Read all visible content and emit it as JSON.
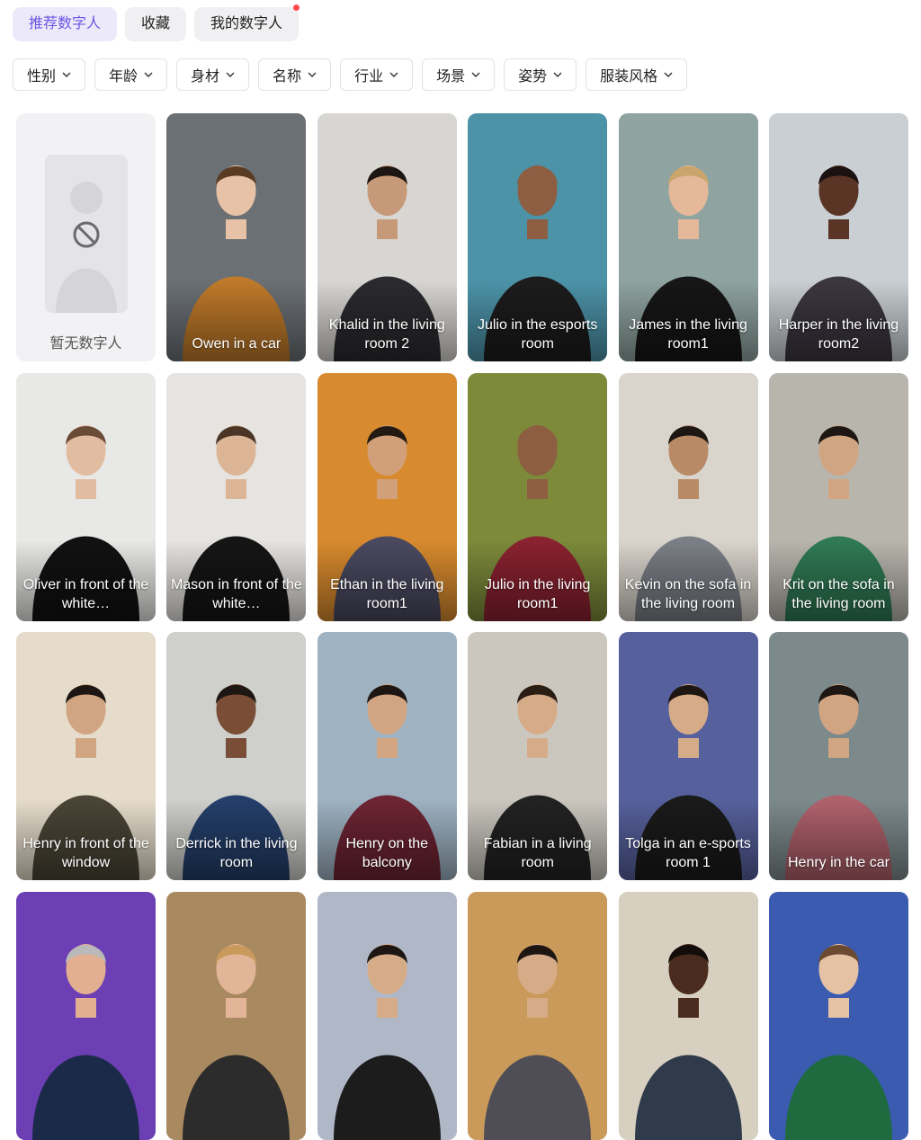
{
  "tabs": [
    {
      "label": "推荐数字人",
      "active": true
    },
    {
      "label": "收藏",
      "active": false
    },
    {
      "label": "我的数字人",
      "active": false,
      "badge_dot": true
    }
  ],
  "filters": [
    {
      "label": "性别"
    },
    {
      "label": "年龄"
    },
    {
      "label": "身材"
    },
    {
      "label": "名称"
    },
    {
      "label": "行业"
    },
    {
      "label": "场景"
    },
    {
      "label": "姿势"
    },
    {
      "label": "服装风格"
    }
  ],
  "empty_card": {
    "label": "暂无数字人",
    "icon": "no-avatar-icon"
  },
  "cards": [
    {
      "name": "Owen in a car",
      "bg": "#6b7075",
      "shirt": "#c07a2a",
      "skin": "#e8c2a6",
      "hair": "#5a3b24"
    },
    {
      "name": "Khalid in the living room 2",
      "bg": "#d8d6d2",
      "shirt": "#2b2b2f",
      "skin": "#c69a78",
      "hair": "#1d1612"
    },
    {
      "name": "Julio in the esports room",
      "bg": "#4c93a8",
      "shirt": "#1c1c1c",
      "skin": "#8d5e42",
      "hair": "#8d5e42"
    },
    {
      "name": "James in the living room1",
      "bg": "#8fa3a0",
      "shirt": "#161616",
      "skin": "#e6b89a",
      "hair": "#c9a56b"
    },
    {
      "name": "Harper in the living room2",
      "bg": "#c9cfd2",
      "shirt": "#3b3640",
      "skin": "#5a3526",
      "hair": "#1a1210"
    },
    {
      "name": "Oliver in front of the white…",
      "bg": "#e8e8e6",
      "shirt": "#111111",
      "skin": "#e2bca0",
      "hair": "#6a4c36"
    },
    {
      "name": "Mason in front of the white…",
      "bg": "#e6e4e0",
      "shirt": "#151515",
      "skin": "#dcb596",
      "hair": "#4a3526"
    },
    {
      "name": "Ethan in the living room1",
      "bg": "#d88a2e",
      "shirt": "#4a4960",
      "skin": "#d1a07a",
      "hair": "#231a14"
    },
    {
      "name": "Julio in the living room1",
      "bg": "#7c8a3a",
      "shirt": "#8a2230",
      "skin": "#8d5e42",
      "hair": "#8d5e42"
    },
    {
      "name": "Kevin on the sofa in the living room",
      "bg": "#d9d4cc",
      "shirt": "#7b7f86",
      "skin": "#b98a66",
      "hair": "#1d1612"
    },
    {
      "name": "Krit on the sofa in the living room",
      "bg": "#b8b5ad",
      "shirt": "#2f7a54",
      "skin": "#d1a582",
      "hair": "#1d1612"
    },
    {
      "name": "Henry in front of the window",
      "bg": "#e5dccb",
      "shirt": "#4a4536",
      "skin": "#d1a582",
      "hair": "#1d1612"
    },
    {
      "name": "Derrick in the living room",
      "bg": "#cfcfcb",
      "shirt": "#243f6b",
      "skin": "#7a4e36",
      "hair": "#1d1612"
    },
    {
      "name": "Henry on the balcony",
      "bg": "#9eb2c2",
      "shirt": "#6e2433",
      "skin": "#d1a582",
      "hair": "#1d1612"
    },
    {
      "name": "Fabian in a living room",
      "bg": "#cbc7bf",
      "shirt": "#222222",
      "skin": "#d6ac88",
      "hair": "#2a1d14"
    },
    {
      "name": "Tolga in an e-sports room 1",
      "bg": "#56609c",
      "shirt": "#1a1a1a",
      "skin": "#d6ac88",
      "hair": "#1d1612"
    },
    {
      "name": "Henry in the car",
      "bg": "#7d8a8c",
      "shirt": "#b0626c",
      "skin": "#d1a582",
      "hair": "#1d1612"
    },
    {
      "name": "",
      "bg": "#6d3fb4",
      "shirt": "#1c2a4a",
      "skin": "#e2b090",
      "hair": "#b9b9b9"
    },
    {
      "name": "",
      "bg": "#a98a60",
      "shirt": "#2c2c2c",
      "skin": "#e2b598",
      "hair": "#c89a5c"
    },
    {
      "name": "",
      "bg": "#b0b8c8",
      "shirt": "#1c1c1c",
      "skin": "#d6ac88",
      "hair": "#1d1612"
    },
    {
      "name": "",
      "bg": "#c99a5a",
      "shirt": "#4f4d56",
      "skin": "#d6ac88",
      "hair": "#1d1612"
    },
    {
      "name": "",
      "bg": "#d7cfc0",
      "shirt": "#2f3a4a",
      "skin": "#4a2c1e",
      "hair": "#120d0a"
    },
    {
      "name": "",
      "bg": "#3a5bb0",
      "shirt": "#1f6a3e",
      "skin": "#e6c2a4",
      "hair": "#6a4a30"
    }
  ]
}
